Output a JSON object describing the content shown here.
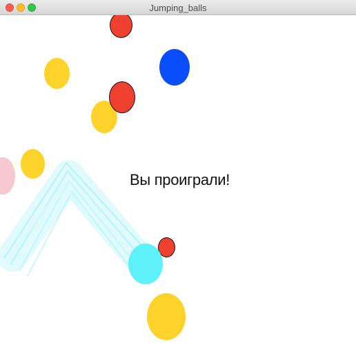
{
  "window": {
    "title": "Jumping_balls"
  },
  "game": {
    "message": "Вы проиграли!",
    "colors": {
      "red": "#f04030",
      "blue": "#0a4dfb",
      "yellow": "#fdd22a",
      "cyan": "#5ff1fa",
      "pink": "#f6c8cf",
      "trail": "#c9f7fb"
    },
    "balls": [
      {
        "name": "red-ball-top",
        "color": "red",
        "outlined": true
      },
      {
        "name": "blue-ball",
        "color": "blue",
        "outlined": false
      },
      {
        "name": "yellow-ball-upper-left",
        "color": "yellow",
        "outlined": false
      },
      {
        "name": "red-ball-middle",
        "color": "red",
        "outlined": true
      },
      {
        "name": "yellow-ball-middle",
        "color": "yellow",
        "outlined": false
      },
      {
        "name": "yellow-ball-left",
        "color": "yellow",
        "outlined": false
      },
      {
        "name": "pink-ball-edge",
        "color": "pink",
        "outlined": false
      },
      {
        "name": "red-ball-small",
        "color": "red",
        "outlined": true
      },
      {
        "name": "cyan-ball-player",
        "color": "cyan",
        "outlined": false
      },
      {
        "name": "yellow-ball-bottom",
        "color": "yellow",
        "outlined": false
      }
    ]
  }
}
